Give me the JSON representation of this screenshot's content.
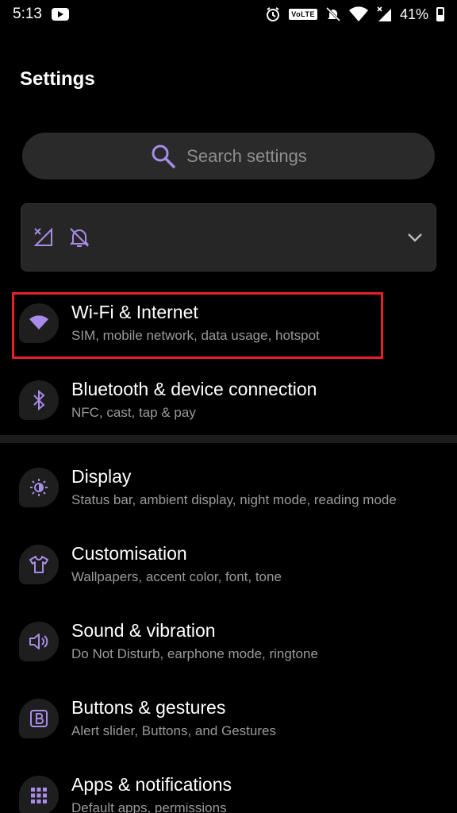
{
  "status_bar": {
    "time": "5:13",
    "volte": "VoLTE",
    "battery": "41%"
  },
  "page": {
    "title": "Settings"
  },
  "search": {
    "placeholder": "Search settings"
  },
  "colors": {
    "accent": "#a98ce8",
    "background": "#000000",
    "card": "#262626",
    "highlight": "#e8202a"
  },
  "settings": [
    {
      "title": "Wi-Fi & Internet",
      "subtitle": "SIM, mobile network, data usage, hotspot",
      "icon": "wifi-icon"
    },
    {
      "title": "Bluetooth & device connection",
      "subtitle": "NFC, cast, tap & pay",
      "icon": "bluetooth-icon"
    },
    {
      "title": "Display",
      "subtitle": "Status bar, ambient display, night mode, reading mode",
      "icon": "brightness-icon"
    },
    {
      "title": "Customisation",
      "subtitle": "Wallpapers, accent color, font, tone",
      "icon": "tshirt-icon"
    },
    {
      "title": "Sound & vibration",
      "subtitle": "Do Not Disturb, earphone mode, ringtone",
      "icon": "speaker-icon"
    },
    {
      "title": "Buttons & gestures",
      "subtitle": "Alert slider, Buttons, and Gestures",
      "icon": "button-b-icon"
    },
    {
      "title": "Apps & notifications",
      "subtitle": "Default apps, permissions",
      "icon": "apps-grid-icon"
    }
  ]
}
